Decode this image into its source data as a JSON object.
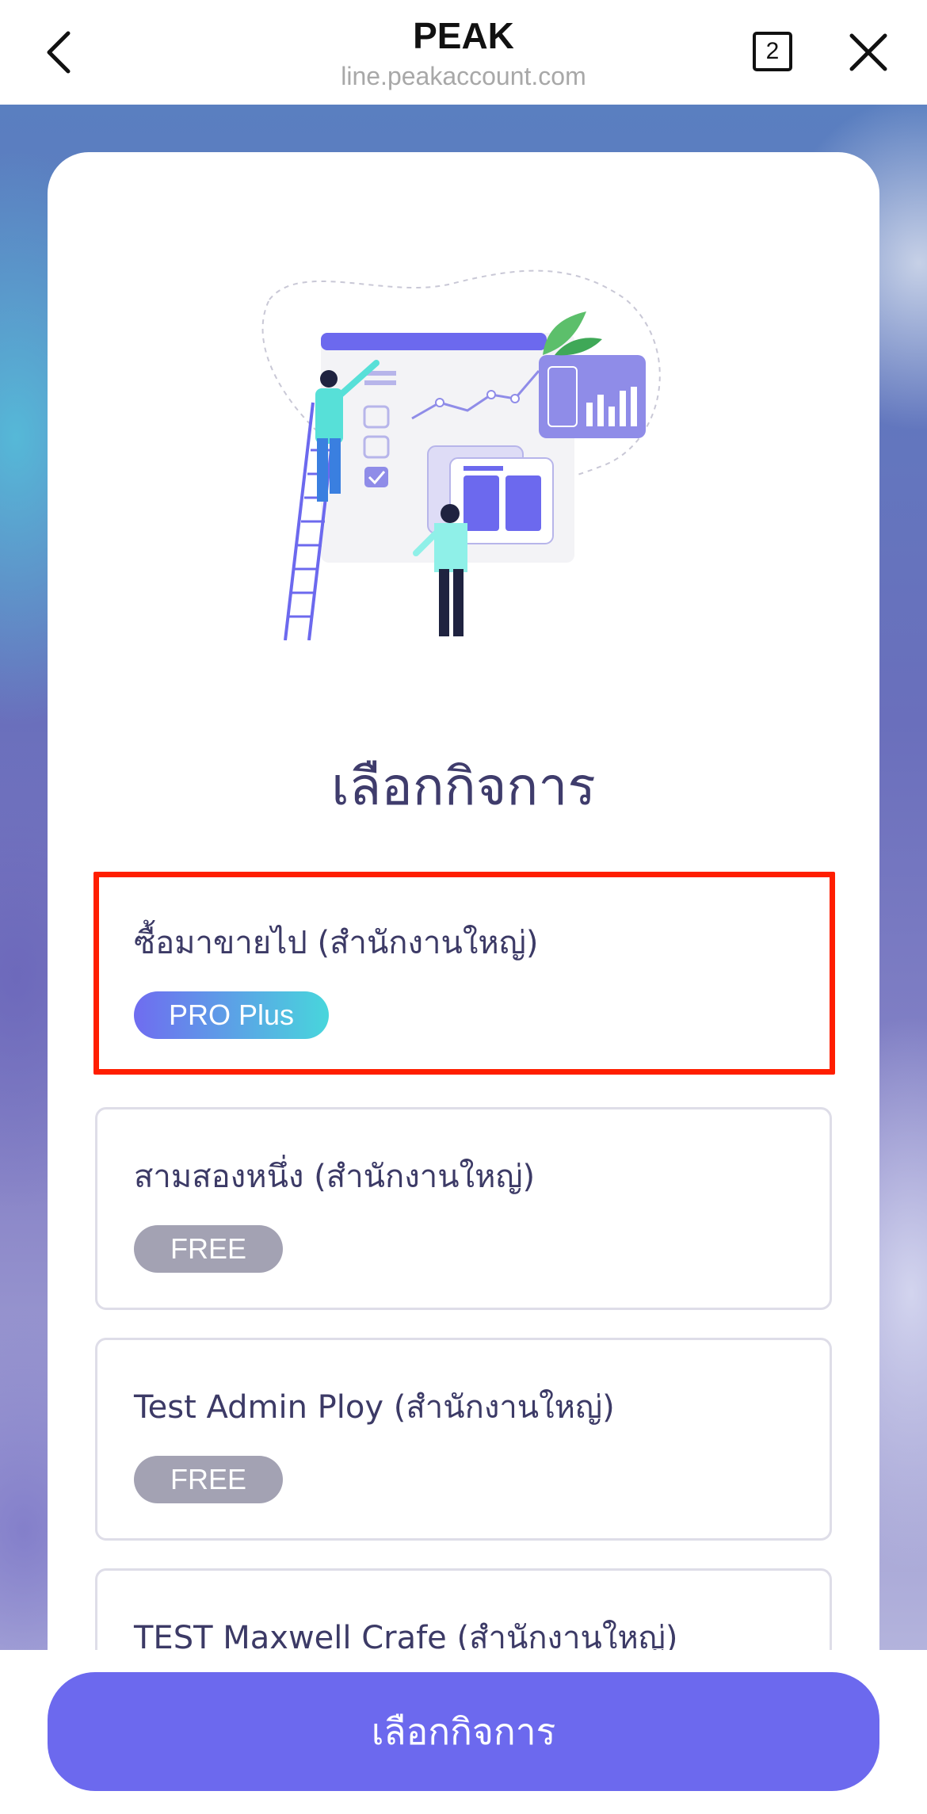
{
  "header": {
    "title": "PEAK",
    "url": "line.peakaccount.com",
    "tab_count": "2",
    "back_icon": "chevron-left-icon",
    "close_icon": "close-icon"
  },
  "main": {
    "heading": "เลือกกิจการ",
    "businesses": [
      {
        "name": "ซื้อมาขายไป (สำนักงานใหญ่)",
        "plan": "PRO Plus",
        "selected": true
      },
      {
        "name": "สามสองหนึ่ง (สำนักงานใหญ่)",
        "plan": "FREE",
        "selected": false
      },
      {
        "name": "Test Admin Ploy (สำนักงานใหญ่)",
        "plan": "FREE",
        "selected": false
      },
      {
        "name": "TEST Maxwell Crafe (สำนักงานใหญ่)",
        "plan": "",
        "selected": false
      }
    ]
  },
  "footer": {
    "select_button_label": "เลือกกิจการ"
  },
  "colors": {
    "accent": "#6c69ee",
    "heading": "#3f3c6c",
    "selection_outline": "#ff1e00",
    "free_badge": "#a3a2b3"
  }
}
